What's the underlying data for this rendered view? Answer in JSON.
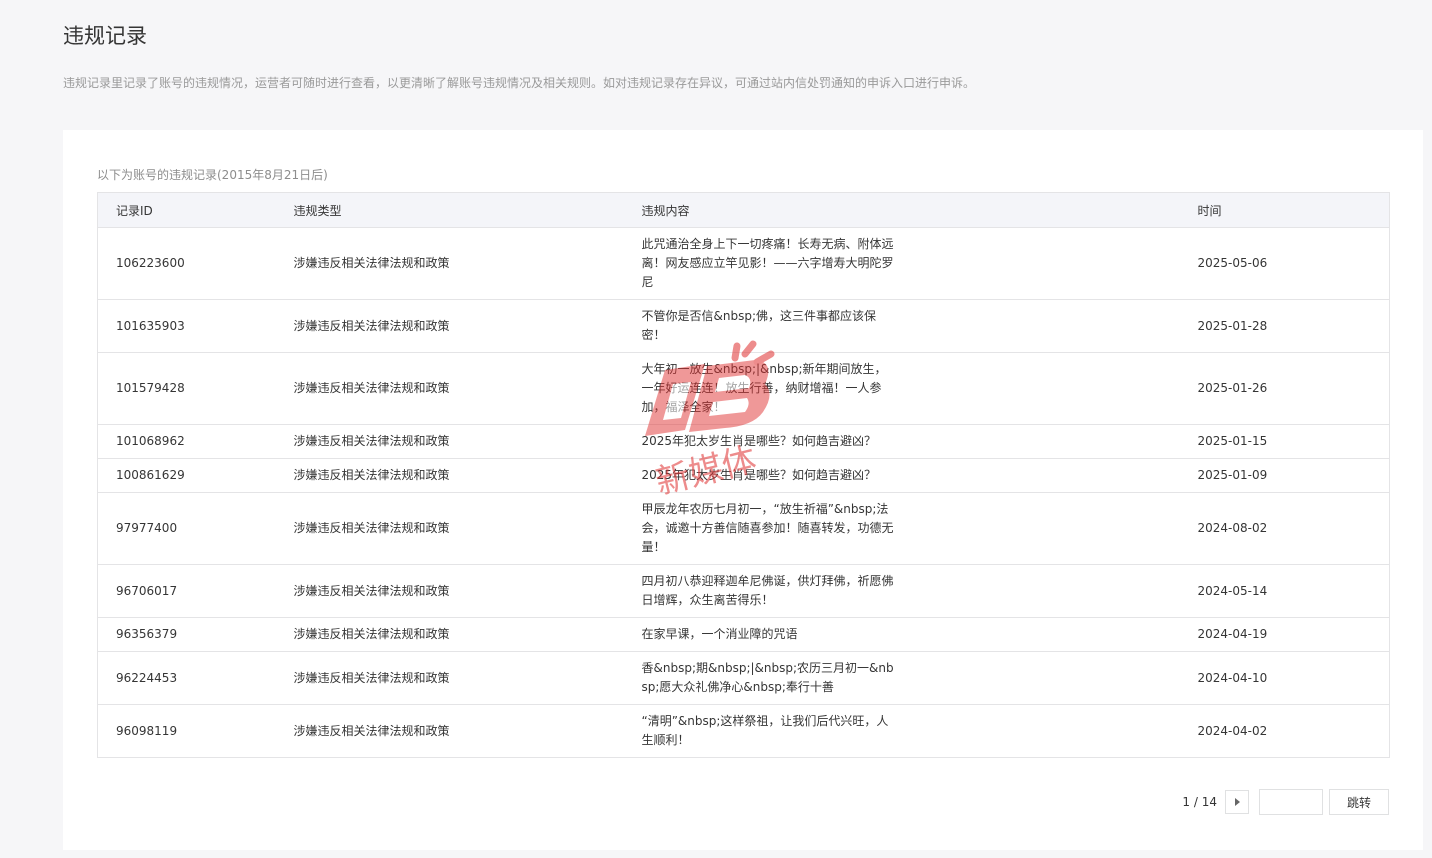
{
  "page": {
    "title": "违规记录",
    "description": "违规记录里记录了账号的违规情况，运营者可随时进行查看，以更清晰了解账号违规情况及相关规则。如对违规记录存在异议，可通过站内信处罚通知的申诉入口进行申诉。"
  },
  "card": {
    "note": "以下为账号的违规记录(2015年8月21日后)"
  },
  "table": {
    "headers": [
      "记录ID",
      "违规类型",
      "违规内容",
      "时间"
    ],
    "rows": [
      {
        "id": "106223600",
        "type": "涉嫌违反相关法律法规和政策",
        "content": "此咒通治全身上下一切疼痛！长寿无病、附体远离！网友感应立竿见影！——六字增寿大明陀罗尼",
        "time": "2025-05-06"
      },
      {
        "id": "101635903",
        "type": "涉嫌违反相关法律法规和政策",
        "content": "不管你是否信&nbsp;佛，这三件事都应该保密！",
        "time": "2025-01-28"
      },
      {
        "id": "101579428",
        "type": "涉嫌违反相关法律法规和政策",
        "content": "大年初一放生&nbsp;|&nbsp;新年期间放生，一年好运连连！放生行善，纳财增福！一人参加，福泽全家！",
        "time": "2025-01-26"
      },
      {
        "id": "101068962",
        "type": "涉嫌违反相关法律法规和政策",
        "content": "2025年犯太岁生肖是哪些？如何趋吉避凶？",
        "time": "2025-01-15"
      },
      {
        "id": "100861629",
        "type": "涉嫌违反相关法律法规和政策",
        "content": "2025年犯太岁生肖是哪些？如何趋吉避凶？",
        "time": "2025-01-09"
      },
      {
        "id": "97977400",
        "type": "涉嫌违反相关法律法规和政策",
        "content": "甲辰龙年农历七月初一，“放生祈福”&nbsp;法会，诚邀十方善信随喜参加！随喜转发，功德无量！",
        "time": "2024-08-02"
      },
      {
        "id": "96706017",
        "type": "涉嫌违反相关法律法规和政策",
        "content": "四月初八恭迎释迦牟尼佛诞，供灯拜佛，祈愿佛日增辉，众生离苦得乐！",
        "time": "2024-05-14"
      },
      {
        "id": "96356379",
        "type": "涉嫌违反相关法律法规和政策",
        "content": "在家早课，一个消业障的咒语",
        "time": "2024-04-19"
      },
      {
        "id": "96224453",
        "type": "涉嫌违反相关法律法规和政策",
        "content": "香&nbsp;期&nbsp;|&nbsp;农历三月初一&nbsp;愿大众礼佛净心&nbsp;奉行十善",
        "time": "2024-04-10"
      },
      {
        "id": "96098119",
        "type": "涉嫌违反相关法律法规和政策",
        "content": "“清明”&nbsp;这样祭祖，让我们后代兴旺，人生顺利！",
        "time": "2024-04-02"
      }
    ]
  },
  "pager": {
    "page_text": "1 / 14",
    "jump_label": "跳转",
    "input_value": ""
  },
  "watermark": {
    "text": "新媒体"
  },
  "colors": {
    "background": "#f6f6f8",
    "header_bg": "#f4f5f9",
    "watermark": "#e03030"
  }
}
